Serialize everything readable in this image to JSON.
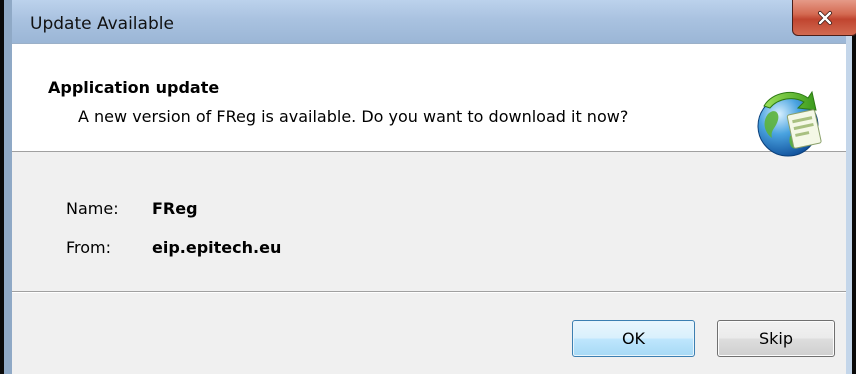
{
  "window": {
    "title": "Update Available",
    "close_glyph": "✕"
  },
  "header": {
    "title": "Application update",
    "description": "A new version of FReg is available. Do you want to download it now?",
    "icon": "globe-update-icon"
  },
  "details": [
    {
      "label": "Name:",
      "value": "FReg"
    },
    {
      "label": "From:",
      "value": "eip.epitech.eu"
    }
  ],
  "buttons": {
    "ok_label": "OK",
    "skip_label": "Skip"
  },
  "colors": {
    "titlebar": "#a9c2e0",
    "close_button": "#c75a42",
    "ok_button_border": "#3c7fb1",
    "client_background": "#f0f0f0"
  }
}
